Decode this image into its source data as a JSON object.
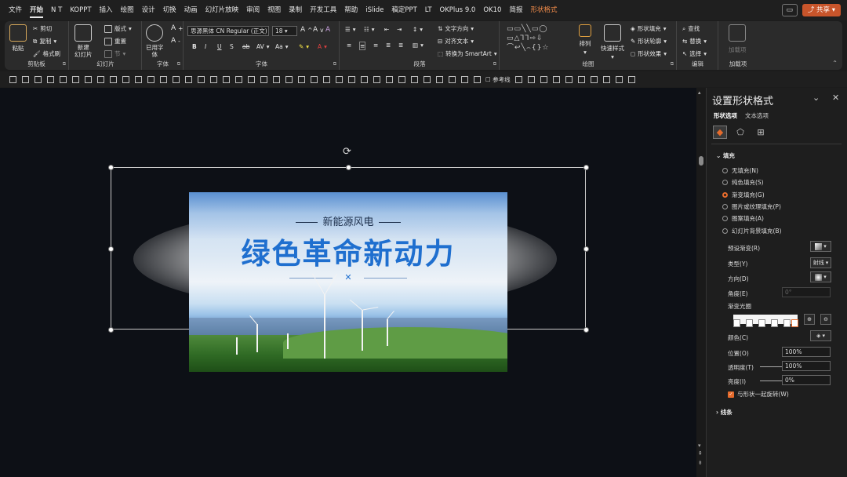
{
  "menubar": {
    "tabs": [
      "文件",
      "开始",
      "N T",
      "KOPPT",
      "插入",
      "绘图",
      "设计",
      "切换",
      "动画",
      "幻灯片放映",
      "审阅",
      "视图",
      "录制",
      "开发工具",
      "帮助",
      "iSlide",
      "稿定PPT",
      "LT",
      "OKPlus 9.0",
      "OK10",
      "简报",
      "形状格式"
    ],
    "active_tab": "开始",
    "context_tab": "形状格式",
    "comment_icon": "comment-icon",
    "share_label": "共享"
  },
  "ribbon": {
    "clipboard": {
      "label": "剪贴板",
      "paste": "粘贴",
      "cut": "剪切",
      "copy": "复制",
      "format_painter": "格式刷"
    },
    "slides": {
      "label": "幻灯片",
      "new_slide": "新建\n幻灯片",
      "layout": "版式",
      "reset": "重置",
      "section": "节"
    },
    "fonts": {
      "label": "字体",
      "used_fonts": "已用字\n体"
    },
    "font": {
      "label": "字体",
      "font_name": "思源黑体 CN Regular (正文)",
      "font_size": "18",
      "bold": "B",
      "italic": "I",
      "underline": "U",
      "strike": "S",
      "av": "AV",
      "aa": "Aa"
    },
    "paragraph": {
      "label": "段落",
      "text_direction": "文字方向",
      "align_text": "对齐文本",
      "smartart": "转换为 SmartArt"
    },
    "drawing": {
      "label": "绘图",
      "arrange": "排列",
      "quick_styles": "快速样式",
      "shape_fill": "形状填充",
      "shape_outline": "形状轮廓",
      "shape_effects": "形状效果"
    },
    "editing": {
      "label": "编辑",
      "find": "查找",
      "replace": "替换",
      "select": "选择"
    },
    "addins": {
      "label": "加载项",
      "addins_btn": "加载项"
    }
  },
  "qat": {
    "guides_label": "参考线"
  },
  "slide": {
    "subtitle": "新能源风电",
    "title": "绿色革命新动力",
    "divider_icon": "windmill-icon",
    "colors": {
      "title": "#1f6fcf",
      "subtitle": "#1c2e4a"
    }
  },
  "panel": {
    "title": "设置形状格式",
    "tabs": [
      "形状选项",
      "文本选项"
    ],
    "active_tab": "形状选项",
    "section_fill": "填充",
    "fill_options": [
      "无填充(N)",
      "纯色填充(S)",
      "渐变填充(G)",
      "图片或纹理填充(P)",
      "图案填充(A)",
      "幻灯片背景填充(B)"
    ],
    "selected_fill": "渐变填充(G)",
    "preset_gradient": "预设渐变(R)",
    "type_label": "类型(Y)",
    "type_value": "射线",
    "direction_label": "方向(D)",
    "angle_label": "角度(E)",
    "angle_value": "0°",
    "stops_label": "渐变光圈",
    "color_label": "颜色(C)",
    "position_label": "位置(O)",
    "position_value": "100%",
    "transparency_label": "透明度(T)",
    "transparency_value": "100%",
    "brightness_label": "亮度(I)",
    "brightness_value": "0%",
    "rotate_with_shape": "与形状一起旋转(W)",
    "rotate_checked": true,
    "section_line": "线条",
    "accent": "#e66b2c"
  }
}
